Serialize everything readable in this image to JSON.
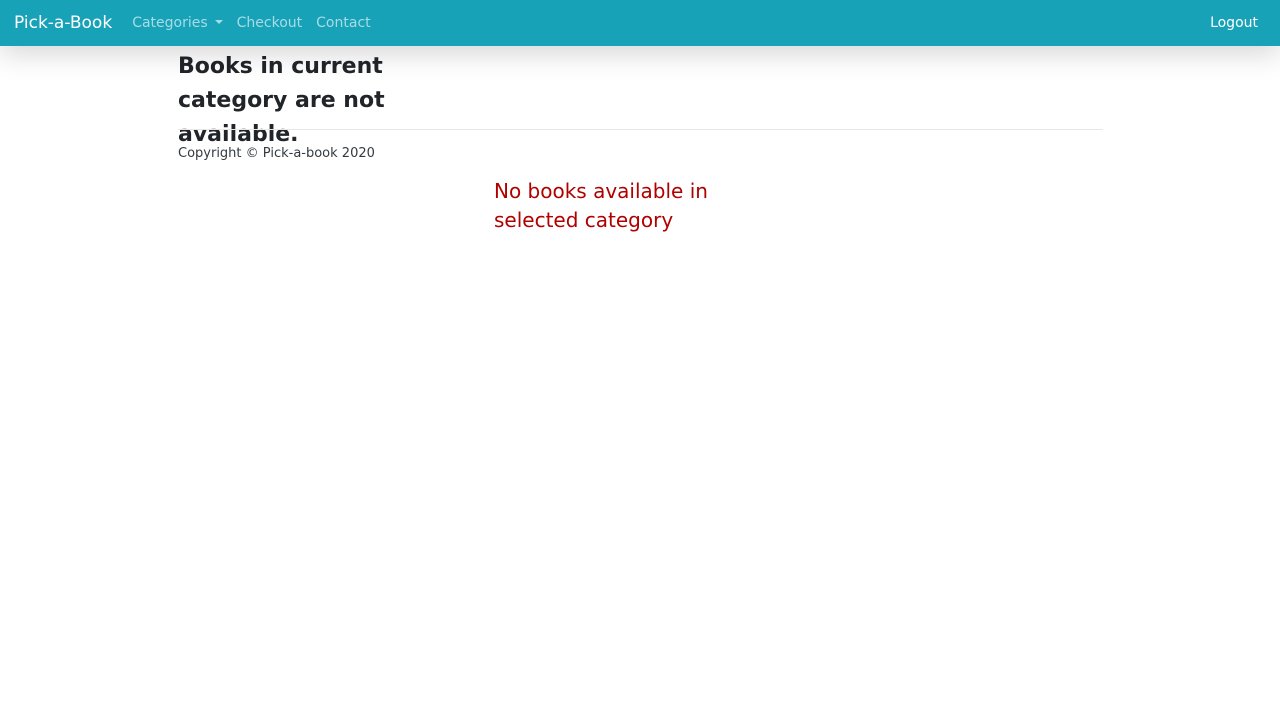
{
  "navbar": {
    "brand": "Pick-a-Book",
    "items": [
      {
        "label": "Categories"
      },
      {
        "label": "Checkout"
      },
      {
        "label": "Contact"
      }
    ],
    "logout_label": "Logout",
    "colors": {
      "background": "#17a2b8"
    }
  },
  "main": {
    "message": "Books in current category are not available."
  },
  "footer": {
    "copyright": "Copyright © Pick-a-book 2020"
  },
  "annotation": {
    "text": "No books available in selected category",
    "color": "#b00000"
  }
}
